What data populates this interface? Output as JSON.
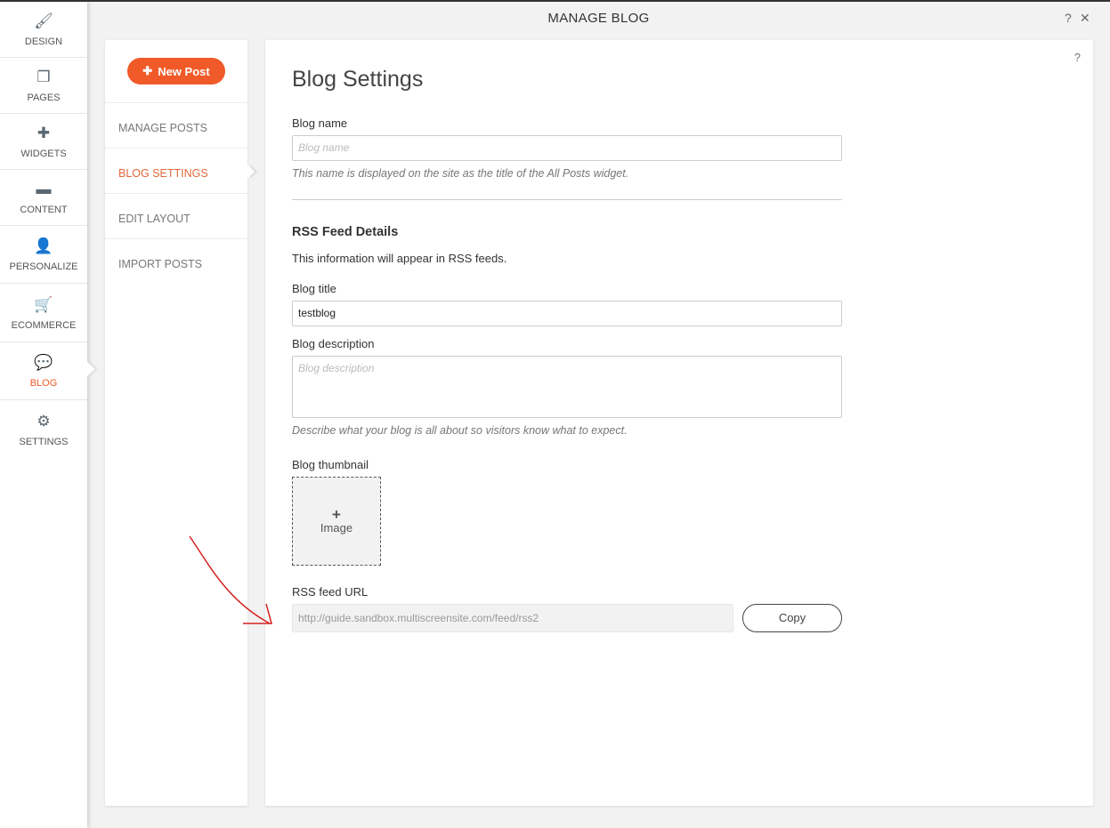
{
  "header": {
    "title": "MANAGE BLOG",
    "help": "?",
    "close": "✕"
  },
  "sidebar": {
    "items": [
      {
        "label": "DESIGN",
        "icon": "brush-icon",
        "glyph": "🖌"
      },
      {
        "label": "PAGES",
        "icon": "pages-icon",
        "glyph": "❐"
      },
      {
        "label": "WIDGETS",
        "icon": "plus-icon",
        "glyph": "✚"
      },
      {
        "label": "CONTENT",
        "icon": "folder-icon",
        "glyph": "▬"
      },
      {
        "label": "PERSONALIZE",
        "icon": "user-icon",
        "glyph": "👤"
      },
      {
        "label": "ECOMMERCE",
        "icon": "cart-icon",
        "glyph": "🛒"
      },
      {
        "label": "BLOG",
        "icon": "chat-bubble-icon",
        "glyph": "💬"
      },
      {
        "label": "SETTINGS",
        "icon": "gear-icon",
        "glyph": "⚙"
      }
    ]
  },
  "subnav": {
    "new_post": "New Post",
    "items": [
      "MANAGE POSTS",
      "BLOG SETTINGS",
      "EDIT LAYOUT",
      "IMPORT POSTS"
    ]
  },
  "main": {
    "help": "?",
    "title": "Blog Settings",
    "blog_name_label": "Blog name",
    "blog_name_placeholder": "Blog name",
    "blog_name_help": "This name is displayed on the site as the title of the All Posts widget.",
    "rss_heading": "RSS Feed Details",
    "rss_sub": "This information will appear in RSS feeds.",
    "blog_title_label": "Blog title",
    "blog_title_value": "testblog",
    "blog_desc_label": "Blog description",
    "blog_desc_placeholder": "Blog description",
    "blog_desc_help": "Describe what your blog is all about so visitors know what to expect.",
    "thumb_label": "Blog thumbnail",
    "thumb_plus": "+",
    "thumb_text": "Image",
    "rss_url_label": "RSS feed URL",
    "rss_url_value": "http://guide.sandbox.multiscreensite.com/feed/rss2",
    "copy": "Copy"
  },
  "colors": {
    "accent": "#f05a28",
    "annotation": "#d42020"
  }
}
